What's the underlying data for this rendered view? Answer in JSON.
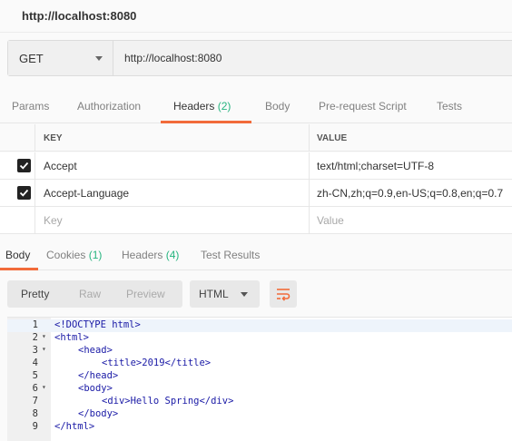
{
  "window": {
    "title": "http://localhost:8080"
  },
  "request": {
    "method": "GET",
    "url": "http://localhost:8080"
  },
  "request_tabs": [
    {
      "label": "Params",
      "count": ""
    },
    {
      "label": "Authorization",
      "count": ""
    },
    {
      "label": "Headers",
      "count": "(2)"
    },
    {
      "label": "Body",
      "count": ""
    },
    {
      "label": "Pre-request Script",
      "count": ""
    },
    {
      "label": "Tests",
      "count": ""
    }
  ],
  "headers_table": {
    "columns": {
      "key": "KEY",
      "value": "VALUE"
    },
    "rows": [
      {
        "key": "Accept",
        "value": "text/html;charset=UTF-8",
        "checked": true
      },
      {
        "key": "Accept-Language",
        "value": "zh-CN,zh;q=0.9,en-US;q=0.8,en;q=0.7",
        "checked": true
      }
    ],
    "placeholder": {
      "key": "Key",
      "value": "Value"
    }
  },
  "response_tabs": [
    {
      "label": "Body",
      "count": ""
    },
    {
      "label": "Cookies",
      "count": "(1)"
    },
    {
      "label": "Headers",
      "count": "(4)"
    },
    {
      "label": "Test Results",
      "count": ""
    }
  ],
  "view_modes": [
    "Pretty",
    "Raw",
    "Preview"
  ],
  "format": "HTML",
  "code_lines": [
    {
      "n": "1",
      "fold": "",
      "indent": 0,
      "text": "<!DOCTYPE html>"
    },
    {
      "n": "2",
      "fold": "▾",
      "indent": 0,
      "text": "<html>"
    },
    {
      "n": "3",
      "fold": "▾",
      "indent": 1,
      "text": "<head>"
    },
    {
      "n": "4",
      "fold": "",
      "indent": 2,
      "text": "<title>2019</title>"
    },
    {
      "n": "5",
      "fold": "",
      "indent": 1,
      "text": "</head>"
    },
    {
      "n": "6",
      "fold": "▾",
      "indent": 1,
      "text": "<body>"
    },
    {
      "n": "7",
      "fold": "",
      "indent": 2,
      "text": "<div>Hello Spring</div>"
    },
    {
      "n": "8",
      "fold": "",
      "indent": 1,
      "text": "</body>"
    },
    {
      "n": "9",
      "fold": "",
      "indent": 0,
      "text": "</html>"
    }
  ],
  "colors": {
    "accent": "#f26b3a",
    "count": "#26b47f",
    "tag": "#1a1aa6"
  }
}
